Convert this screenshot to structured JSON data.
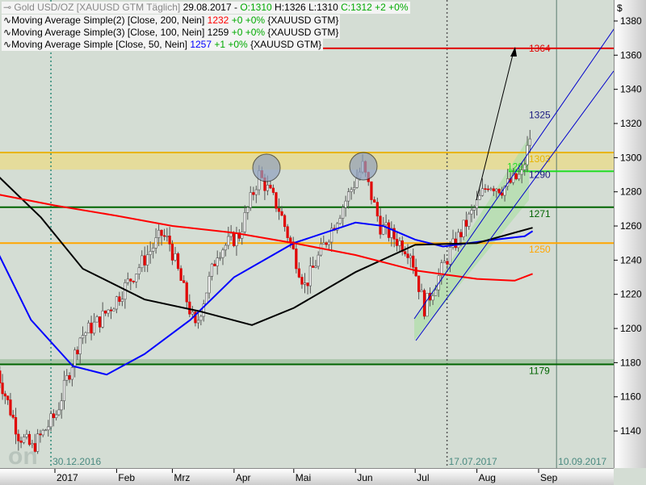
{
  "header": {
    "title": "Gold USD/OZ [XAUUSD GTM  Täglich]",
    "date": "29.08.2017 -",
    "open": "O:1310",
    "high": "H:1326",
    "low": "L:1310",
    "close": "C:1312 +2 +0%"
  },
  "indicators": [
    {
      "name": "Moving Average Simple(2) [Close, 200, Nein]",
      "value": "1232",
      "change": "+0 +0%",
      "symbol": "{XAUUSD GTM}",
      "color": "#ff0000"
    },
    {
      "name": "Moving Average Simple(3) [Close, 100, Nein]",
      "value": "1259",
      "change": "+0 +0%",
      "symbol": "{XAUUSD GTM}",
      "color": "#000000"
    },
    {
      "name": "Moving Average Simple [Close, 50, Nein]",
      "value": "1257",
      "change": "+1 +0%",
      "symbol": "{XAUUSD GTM}",
      "color": "#0000ff"
    }
  ],
  "watermark": "tradesignal online",
  "chart_data": {
    "type": "candlestick",
    "currency_symbol": "$",
    "ylim": [
      1125,
      1390
    ],
    "yticks": [
      1140,
      1160,
      1180,
      1200,
      1220,
      1240,
      1260,
      1280,
      1300,
      1320,
      1340,
      1360,
      1380
    ],
    "xticks": [
      {
        "label": "2017",
        "date": "2017-01-01"
      },
      {
        "label": "Feb",
        "date": "2017-02-01"
      },
      {
        "label": "Mrz",
        "date": "2017-03-01"
      },
      {
        "label": "Apr",
        "date": "2017-04-01"
      },
      {
        "label": "Mai",
        "date": "2017-05-01"
      },
      {
        "label": "Jun",
        "date": "2017-06-01"
      },
      {
        "label": "Jul",
        "date": "2017-07-01"
      },
      {
        "label": "Aug",
        "date": "2017-08-01"
      },
      {
        "label": "Sep",
        "date": "2017-09-01"
      }
    ],
    "date_markers": [
      {
        "label": "30.12.2016",
        "date": "2016-12-30",
        "style": "dotted",
        "color": "#2e8b7a"
      },
      {
        "label": "17.07.2017",
        "date": "2017-07-17",
        "style": "dotted",
        "color": "#555555"
      },
      {
        "label": "10.09.2017",
        "date": "2017-09-10",
        "style": "solid",
        "color": "#5a7a70"
      }
    ],
    "price_keypoints": [
      [
        "2016-12-03",
        1180
      ],
      [
        "2016-12-15",
        1138
      ],
      [
        "2016-12-22",
        1130
      ],
      [
        "2017-01-03",
        1150
      ],
      [
        "2017-01-15",
        1195
      ],
      [
        "2017-01-25",
        1205
      ],
      [
        "2017-02-01",
        1215
      ],
      [
        "2017-02-25",
        1255
      ],
      [
        "2017-03-01",
        1250
      ],
      [
        "2017-03-14",
        1200
      ],
      [
        "2017-03-25",
        1245
      ],
      [
        "2017-04-05",
        1255
      ],
      [
        "2017-04-15",
        1290
      ],
      [
        "2017-04-25",
        1270
      ],
      [
        "2017-05-08",
        1225
      ],
      [
        "2017-05-20",
        1255
      ],
      [
        "2017-06-06",
        1295
      ],
      [
        "2017-06-15",
        1260
      ],
      [
        "2017-06-30",
        1245
      ],
      [
        "2017-07-07",
        1212
      ],
      [
        "2017-07-20",
        1245
      ],
      [
        "2017-08-01",
        1270
      ],
      [
        "2017-08-08",
        1285
      ],
      [
        "2017-08-15",
        1282
      ],
      [
        "2017-08-25",
        1290
      ],
      [
        "2017-08-29",
        1312
      ]
    ],
    "series": [
      {
        "name": "Moving Average Simple [Close, 50, Nein]",
        "color": "#0000ff",
        "points": [
          [
            "2016-12-01",
            1250
          ],
          [
            "2016-12-20",
            1205
          ],
          [
            "2017-01-10",
            1178
          ],
          [
            "2017-01-27",
            1173
          ],
          [
            "2017-02-15",
            1185
          ],
          [
            "2017-03-10",
            1205
          ],
          [
            "2017-04-01",
            1230
          ],
          [
            "2017-05-01",
            1250
          ],
          [
            "2017-06-01",
            1262
          ],
          [
            "2017-06-15",
            1260
          ],
          [
            "2017-07-01",
            1252
          ],
          [
            "2017-07-15",
            1248
          ],
          [
            "2017-08-10",
            1252
          ],
          [
            "2017-08-25",
            1254
          ],
          [
            "2017-08-29",
            1257
          ]
        ]
      },
      {
        "name": "Moving Average Simple(3) [Close, 100, Nein]",
        "color": "#000000",
        "points": [
          [
            "2016-12-01",
            1292
          ],
          [
            "2016-12-25",
            1265
          ],
          [
            "2017-01-15",
            1235
          ],
          [
            "2017-02-15",
            1217
          ],
          [
            "2017-03-15",
            1210
          ],
          [
            "2017-04-10",
            1202
          ],
          [
            "2017-05-01",
            1212
          ],
          [
            "2017-06-01",
            1233
          ],
          [
            "2017-07-01",
            1249
          ],
          [
            "2017-08-01",
            1250
          ],
          [
            "2017-08-29",
            1259
          ]
        ]
      },
      {
        "name": "Moving Average Simple(2) [Close, 200, Nein]",
        "color": "#ff0000",
        "points": [
          [
            "2016-12-01",
            1279
          ],
          [
            "2017-01-01",
            1272
          ],
          [
            "2017-02-01",
            1266
          ],
          [
            "2017-03-01",
            1260
          ],
          [
            "2017-04-01",
            1256
          ],
          [
            "2017-05-01",
            1250
          ],
          [
            "2017-06-01",
            1243
          ],
          [
            "2017-07-01",
            1234
          ],
          [
            "2017-08-01",
            1229
          ],
          [
            "2017-08-20",
            1228
          ],
          [
            "2017-08-29",
            1232
          ]
        ]
      }
    ],
    "levels": [
      {
        "value": 1364,
        "label": "1364",
        "color": "#e00000"
      },
      {
        "value": 1303,
        "label": "1303",
        "color": "#e8b400"
      },
      {
        "value": 1292,
        "label": "1292",
        "color": "#22dd22"
      },
      {
        "value": 1271,
        "label": "1271",
        "color": "#006400"
      },
      {
        "value": 1250,
        "label": "1250",
        "color": "#ffa500"
      },
      {
        "value": 1179,
        "label": "1179",
        "color": "#006400"
      }
    ],
    "annotations": [
      {
        "label": "1325",
        "value": 1325
      },
      {
        "label": "1290",
        "value": 1290
      }
    ],
    "zones": [
      {
        "from": 1293,
        "to": 1303,
        "color": "#e8dc8c"
      },
      {
        "from": 1179,
        "to": 1182,
        "color": "#9fbf9f"
      }
    ]
  }
}
